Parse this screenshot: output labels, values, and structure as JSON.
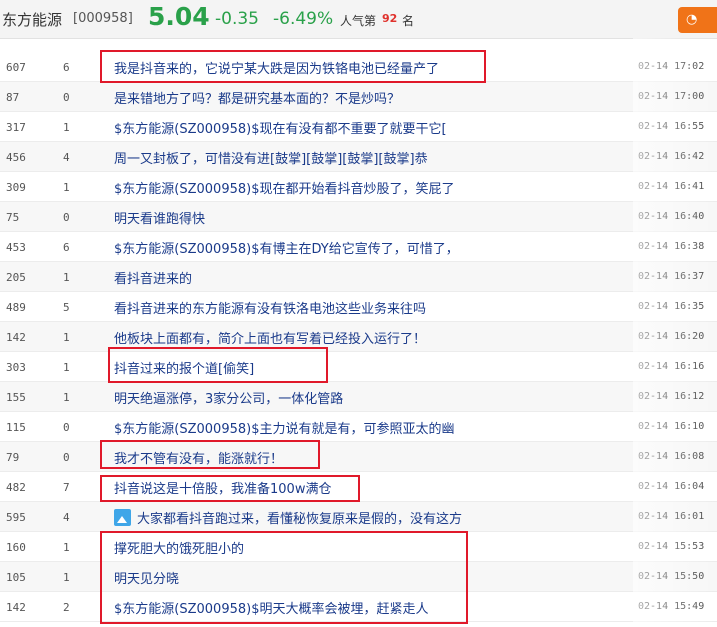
{
  "header": {
    "stock_name": "东方能源",
    "stock_code": "[000958]",
    "price": "5.04",
    "change": "-0.35",
    "change_pct": "-6.49%",
    "popularity_label": "人气第",
    "popularity_rank": "92",
    "popularity_suffix": "名",
    "plus_button_icon": "speech-icon"
  },
  "colors": {
    "down_green": "#2aa14a",
    "link_blue": "#1a3a8a",
    "highlight_red": "#e0192a",
    "accent_orange": "#f07318"
  },
  "posts": [
    {
      "reads": "607",
      "replies": "6",
      "title": "我是抖音来的，它说宁某大跌是因为铁铬电池已经量产了",
      "date": "02-14 17:02"
    },
    {
      "reads": "87",
      "replies": "0",
      "title": "是来错地方了吗？都是研究基本面的？不是炒吗？",
      "date": "02-14 17:00"
    },
    {
      "reads": "317",
      "replies": "1",
      "title": "$东方能源(SZ000958)$现在有没有都不重要了就要干它[",
      "date": "02-14 16:55"
    },
    {
      "reads": "456",
      "replies": "4",
      "title": "周一又封板了，可惜没有进[鼓掌][鼓掌][鼓掌][鼓掌]恭",
      "date": "02-14 16:42"
    },
    {
      "reads": "309",
      "replies": "1",
      "title": "$东方能源(SZ000958)$现在都开始看抖音炒股了，笑屁了",
      "date": "02-14 16:41"
    },
    {
      "reads": "75",
      "replies": "0",
      "title": "明天看谁跑得快",
      "date": "02-14 16:40"
    },
    {
      "reads": "453",
      "replies": "6",
      "title": "$东方能源(SZ000958)$有博主在DY给它宣传了，可惜了，",
      "date": "02-14 16:38"
    },
    {
      "reads": "205",
      "replies": "1",
      "title": "看抖音进来的",
      "date": "02-14 16:37"
    },
    {
      "reads": "489",
      "replies": "5",
      "title": "看抖音进来的东方能源有没有铁洛电池这些业务来往吗",
      "date": "02-14 16:35"
    },
    {
      "reads": "142",
      "replies": "1",
      "title": "他板块上面都有，简介上面也有写着已经投入运行了！",
      "date": "02-14 16:20"
    },
    {
      "reads": "303",
      "replies": "1",
      "title": "抖音过来的报个道[偷笑]",
      "date": "02-14 16:16"
    },
    {
      "reads": "155",
      "replies": "1",
      "title": "明天绝逼涨停，3家分公司，一体化管路",
      "date": "02-14 16:12"
    },
    {
      "reads": "115",
      "replies": "0",
      "title": "$东方能源(SZ000958)$主力说有就是有，可参照亚太的幽",
      "date": "02-14 16:10"
    },
    {
      "reads": "79",
      "replies": "0",
      "title": "我才不管有没有，能涨就行！",
      "date": "02-14 16:08"
    },
    {
      "reads": "482",
      "replies": "7",
      "title": "抖音说这是十倍股，我准备100w满仓",
      "date": "02-14 16:04"
    },
    {
      "reads": "595",
      "replies": "4",
      "title": "大家都看抖音跑过来，看懂秘恢复原来是假的，没有这方",
      "date": "02-14 16:01",
      "icon": "image-icon"
    },
    {
      "reads": "160",
      "replies": "1",
      "title": "撑死胆大的饿死胆小的",
      "date": "02-14 15:53"
    },
    {
      "reads": "105",
      "replies": "1",
      "title": "明天见分晓",
      "date": "02-14 15:50"
    },
    {
      "reads": "142",
      "replies": "2",
      "title": "$东方能源(SZ000958)$明天大概率会被埋，赶紧走人",
      "date": "02-14 15:49"
    }
  ]
}
